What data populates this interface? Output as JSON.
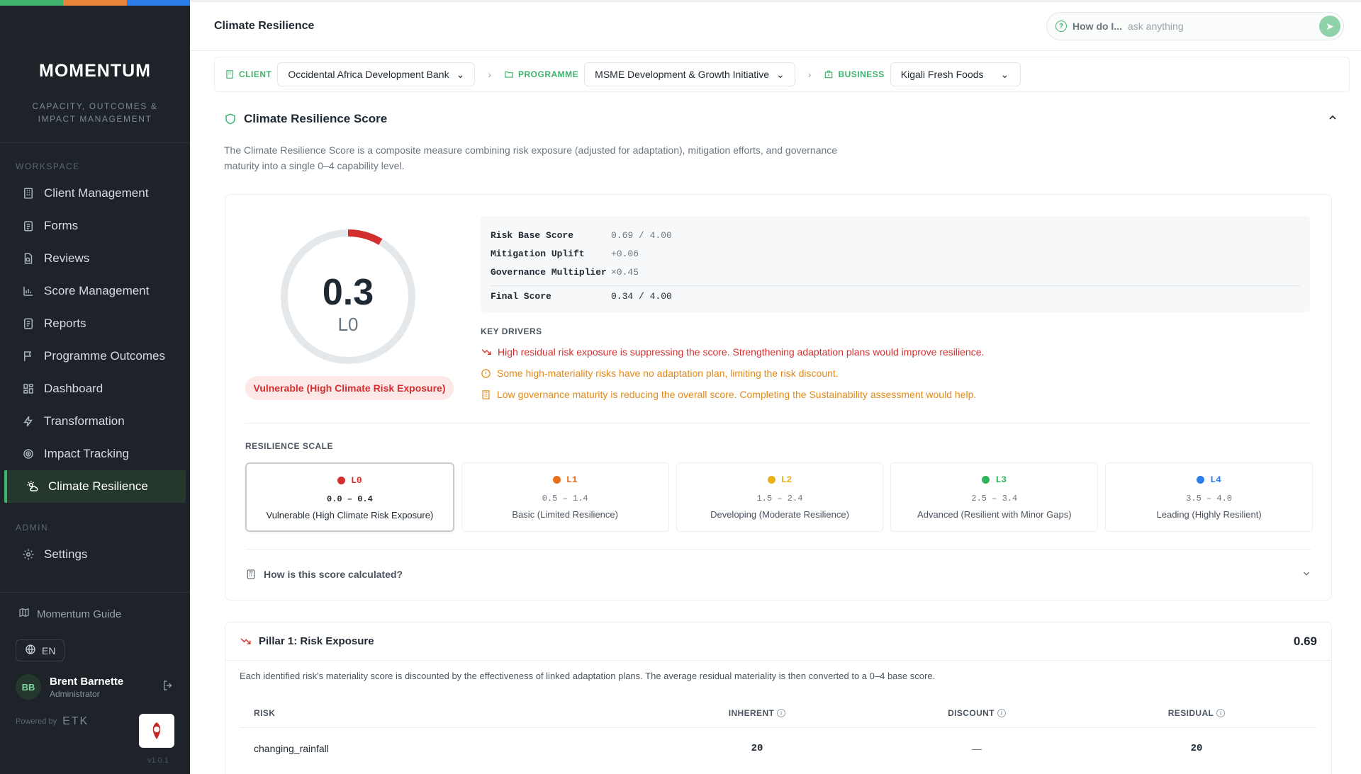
{
  "brand": {
    "logo": "MOMENTUM",
    "tagline_1": "CAPACITY, OUTCOMES &",
    "tagline_2": "IMPACT MANAGEMENT"
  },
  "sidebar": {
    "workspace_label": "WORKSPACE",
    "items": [
      {
        "label": "Client Management",
        "icon": "building-icon"
      },
      {
        "label": "Forms",
        "icon": "clipboard-icon"
      },
      {
        "label": "Reviews",
        "icon": "file-search-icon"
      },
      {
        "label": "Score Management",
        "icon": "bar-chart-icon"
      },
      {
        "label": "Reports",
        "icon": "report-icon"
      },
      {
        "label": "Programme Outcomes",
        "icon": "flag-icon"
      },
      {
        "label": "Dashboard",
        "icon": "grid-icon"
      },
      {
        "label": "Transformation",
        "icon": "lightning-icon"
      },
      {
        "label": "Impact Tracking",
        "icon": "target-icon"
      },
      {
        "label": "Climate Resilience",
        "icon": "sun-cloud-icon",
        "active": true
      }
    ],
    "admin_label": "ADMIN",
    "settings_label": "Settings",
    "guide_label": "Momentum Guide",
    "lang": "EN",
    "user": {
      "initials": "BB",
      "name": "Brent Barnette",
      "role": "Administrator"
    },
    "powered_by": "Powered by",
    "powered_brand": "ETK",
    "version": "v1.0.1",
    "accent_colors": [
      "#3fb26b",
      "#e8833a",
      "#2b7de9"
    ]
  },
  "header": {
    "title": "Climate Resilience",
    "ask_how": "How do I...",
    "ask_placeholder": "ask anything"
  },
  "crumbs": {
    "client_label": "CLIENT",
    "client_value": "Occidental Africa Development Bank",
    "programme_label": "PROGRAMME",
    "programme_value": "MSME Development & Growth Initiative",
    "business_label": "BUSINESS",
    "business_value": "Kigali Fresh Foods"
  },
  "score_section": {
    "title": "Climate Resilience Score",
    "description": "The Climate Resilience Score is a composite measure combining risk exposure (adjusted for adaptation), mitigation efforts, and governance maturity into a single 0–4 capability level.",
    "gauge_value": "0.3",
    "gauge_level": "L0",
    "gauge_fraction": 0.085,
    "badge": "Vulnerable (High Climate Risk Exposure)",
    "breakdown": [
      {
        "key": "Risk Base Score",
        "value": "0.69 / 4.00"
      },
      {
        "key": "Mitigation Uplift",
        "value": "+0.06"
      },
      {
        "key": "Governance Multiplier",
        "value": "×0.45"
      }
    ],
    "final": {
      "key": "Final Score",
      "value": "0.34 / 4.00"
    },
    "drivers_label": "KEY DRIVERS",
    "drivers": [
      {
        "text": "High residual risk exposure is suppressing the score. Strengthening adaptation plans would improve resilience.",
        "tone": "red",
        "icon": "trend-down-icon"
      },
      {
        "text": "Some high-materiality risks have no adaptation plan, limiting the risk discount.",
        "tone": "orange",
        "icon": "info-circle-icon"
      },
      {
        "text": "Low governance maturity is reducing the overall score. Completing the Sustainability assessment would help.",
        "tone": "orange",
        "icon": "building-icon"
      }
    ],
    "scale_label": "RESILIENCE SCALE",
    "levels": [
      {
        "code": "L0",
        "range": "0.0 – 0.4",
        "desc": "Vulnerable (High Climate Risk Exposure)",
        "color": "#d32f2f"
      },
      {
        "code": "L1",
        "range": "0.5 – 1.4",
        "desc": "Basic (Limited Resilience)",
        "color": "#e8701a"
      },
      {
        "code": "L2",
        "range": "1.5 – 2.4",
        "desc": "Developing (Moderate Resilience)",
        "color": "#e8b01a"
      },
      {
        "code": "L3",
        "range": "2.5 – 3.4",
        "desc": "Advanced (Resilient with Minor Gaps)",
        "color": "#2fb35a"
      },
      {
        "code": "L4",
        "range": "3.5 – 4.0",
        "desc": "Leading (Highly Resilient)",
        "color": "#2b7de9"
      }
    ],
    "how_calc": "How is this score calculated?"
  },
  "pillar": {
    "title": "Pillar 1: Risk Exposure",
    "score": "0.69",
    "description": "Each identified risk's materiality score is discounted by the effectiveness of linked adaptation plans. The average residual materiality is then converted to a 0–4 base score.",
    "columns": {
      "risk": "RISK",
      "inherent": "INHERENT",
      "discount": "DISCOUNT",
      "residual": "RESIDUAL"
    },
    "rows": [
      {
        "risk": "changing_rainfall",
        "inherent": "20",
        "discount": "—",
        "residual": "20"
      }
    ]
  }
}
